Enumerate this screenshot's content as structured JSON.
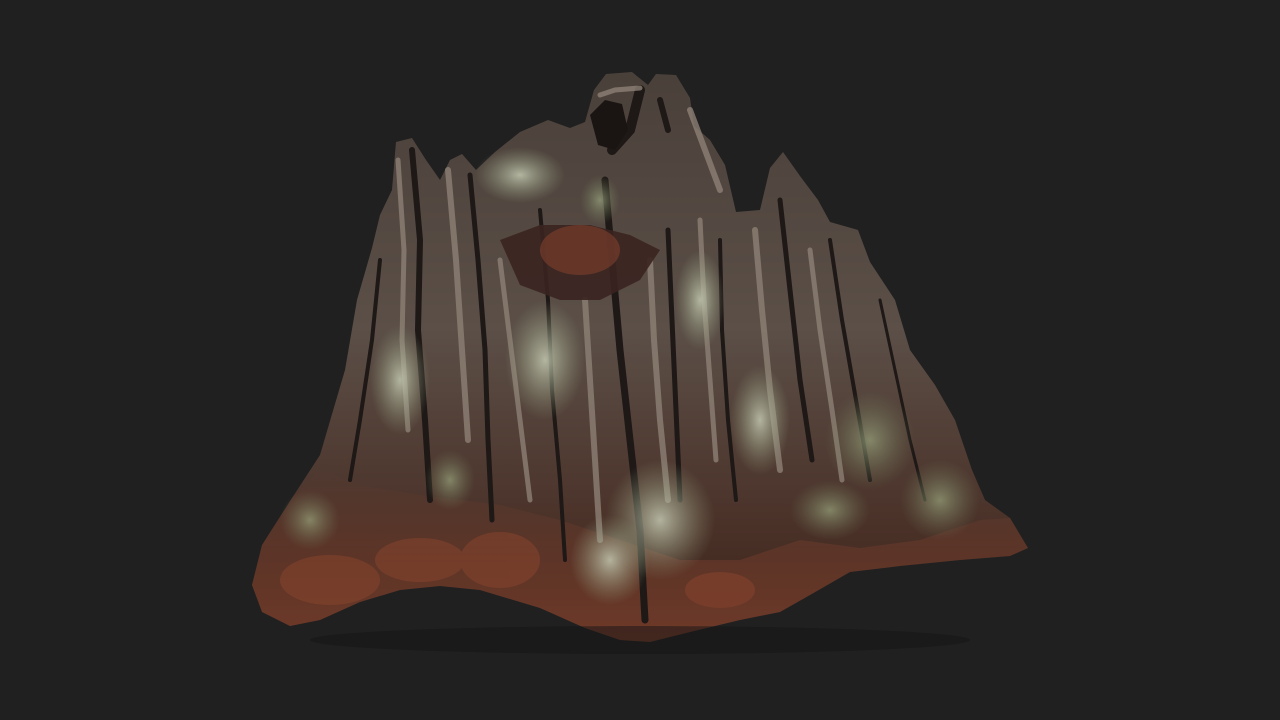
{
  "scene": {
    "subject": "tree-stump-3d-scan",
    "background_color": "#202020",
    "colors": {
      "bark_dark": "#2a2421",
      "bark_mid": "#5a4b43",
      "bark_light": "#8a7d72",
      "moss": "#8f9a7a",
      "lichen": "#b9bfa7",
      "rust": "#7a3f2c"
    }
  }
}
